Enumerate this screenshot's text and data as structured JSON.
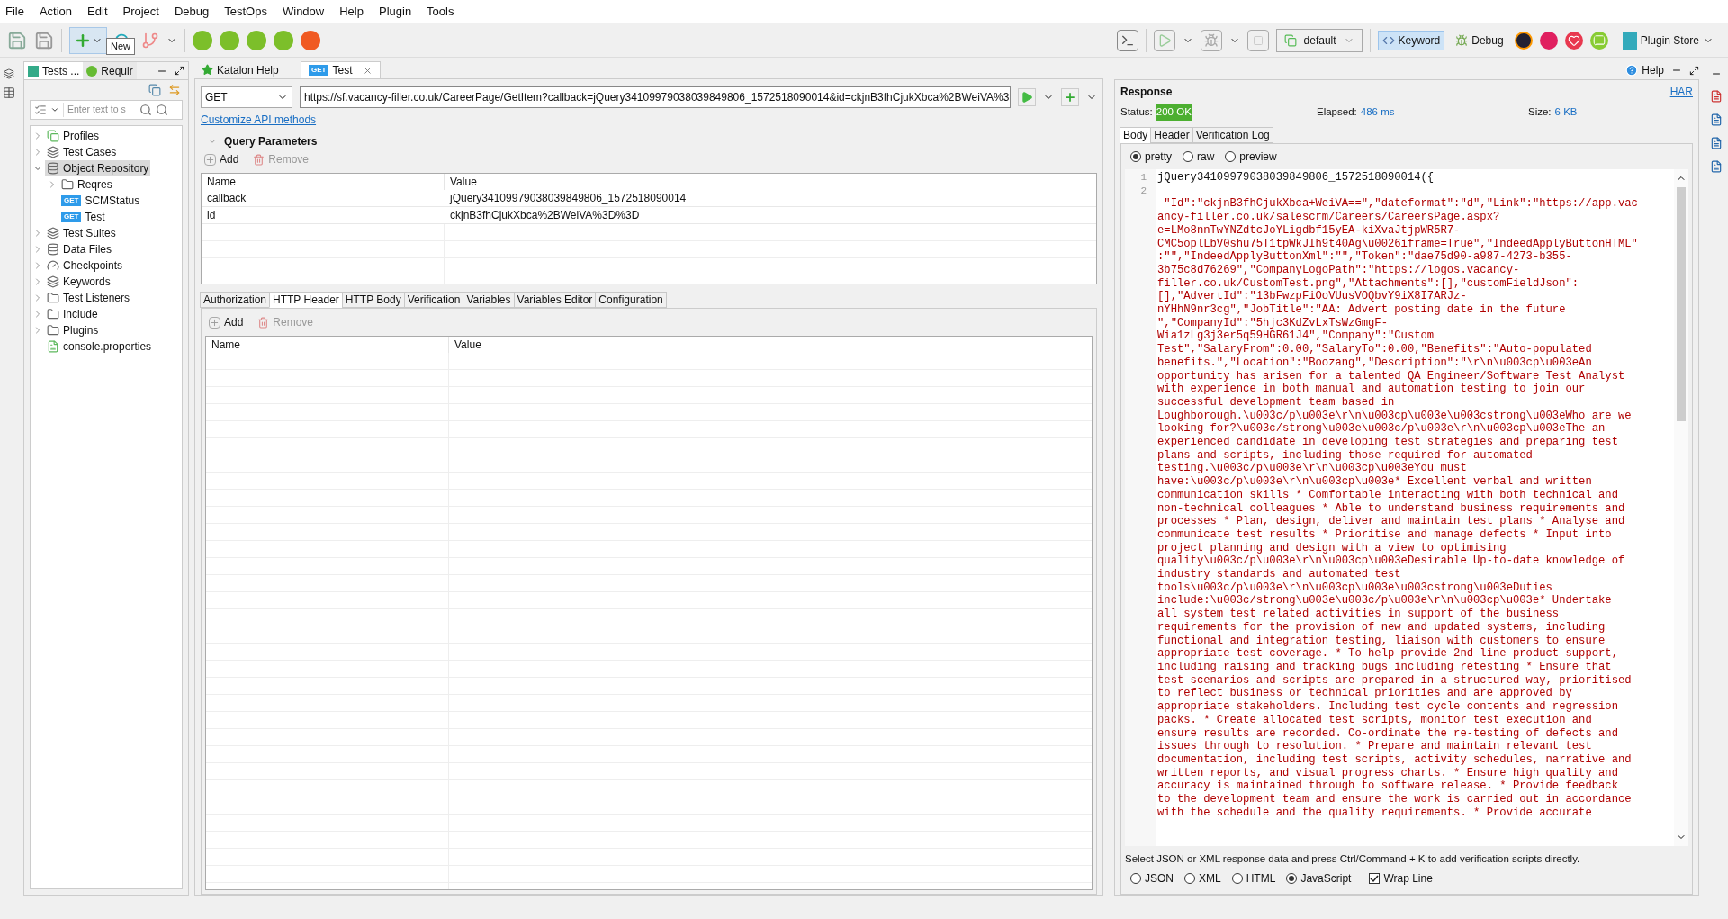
{
  "menu": [
    "File",
    "Action",
    "Edit",
    "Project",
    "Debug",
    "TestOps",
    "Window",
    "Help",
    "Plugin",
    "Tools"
  ],
  "toolbar": {
    "tooltip": "New",
    "profile": "default",
    "perspectives": [
      {
        "label": "Keyword",
        "selected": true
      },
      {
        "label": "Debug",
        "selected": false
      }
    ],
    "plugin_store": "Plugin Store"
  },
  "explorer": {
    "tabs": [
      {
        "label": "Tests ...",
        "selected": true
      },
      {
        "label": "Requir",
        "selected": false
      }
    ],
    "search": {
      "placeholder": "Enter text to s"
    },
    "tree": [
      {
        "label": "Profiles",
        "kind": "profiles",
        "expanded": false,
        "selected": false
      },
      {
        "label": "Test Cases",
        "kind": "cases",
        "expanded": false,
        "selected": false
      },
      {
        "label": "Object Repository",
        "kind": "repo",
        "expanded": true,
        "selected": true,
        "children": [
          {
            "label": "Reqres",
            "kind": "folder",
            "expanded": false,
            "selected": false
          },
          {
            "label": "SCMStatus",
            "kind": "request",
            "badge": "GET",
            "selected": false
          },
          {
            "label": "Test",
            "kind": "request",
            "badge": "GET",
            "selected": false
          }
        ]
      },
      {
        "label": "Test Suites",
        "kind": "cases",
        "expanded": false,
        "selected": false
      },
      {
        "label": "Data Files",
        "kind": "data",
        "expanded": false,
        "selected": false
      },
      {
        "label": "Checkpoints",
        "kind": "checkpoint",
        "expanded": false,
        "selected": false
      },
      {
        "label": "Keywords",
        "kind": "cases",
        "expanded": false,
        "selected": false
      },
      {
        "label": "Test Listeners",
        "kind": "folder",
        "expanded": false,
        "selected": false
      },
      {
        "label": "Include",
        "kind": "folder",
        "expanded": false,
        "selected": false
      },
      {
        "label": "Plugins",
        "kind": "folder",
        "expanded": false,
        "selected": false
      },
      {
        "label": "console.properties",
        "kind": "file",
        "selected": false
      }
    ]
  },
  "editor_tabs": [
    {
      "label": "Katalon Help",
      "selected": false
    },
    {
      "label": "Test",
      "badge": "GET",
      "selected": true
    }
  ],
  "help": "Help",
  "request": {
    "method": "GET",
    "url": "https://sf.vacancy-filler.co.uk/CareerPage/GetItem?callback=jQuery34109979038039849806_1572518090014&id=ckjnB3fhCjukXbca%2BWeiVA%3",
    "customize_link": "Customize API methods",
    "query": {
      "title": "Query Parameters",
      "expanded": true,
      "add": "Add",
      "remove": "Remove",
      "columns": [
        "Name",
        "Value"
      ],
      "rows": [
        [
          "callback",
          "jQuery34109979038039849806_1572518090014"
        ],
        [
          "id",
          "ckjnB3fhCjukXbca%2BWeiVA%3D%3D"
        ]
      ]
    },
    "tabs": [
      {
        "label": "Authorization",
        "selected": false
      },
      {
        "label": "HTTP Header",
        "selected": true
      },
      {
        "label": "HTTP Body",
        "selected": false
      },
      {
        "label": "Verification",
        "selected": false
      },
      {
        "label": "Variables",
        "selected": false
      },
      {
        "label": "Variables Editor",
        "selected": false
      },
      {
        "label": "Configuration",
        "selected": false
      }
    ],
    "header_table": {
      "add": "Add",
      "remove": "Remove",
      "columns": [
        "Name",
        "Value"
      ]
    }
  },
  "response": {
    "title": "Response",
    "har": "HAR",
    "status_label": "Status:",
    "status": "200 OK",
    "elapsed_label": "Elapsed:",
    "elapsed": "486 ms",
    "size_label": "Size:",
    "size": "6 KB",
    "tabs": [
      {
        "label": "Body",
        "selected": true
      },
      {
        "label": "Header",
        "selected": false
      },
      {
        "label": "Verification Log",
        "selected": false
      }
    ],
    "modes": [
      {
        "label": "pretty",
        "selected": true
      },
      {
        "label": "raw",
        "selected": false
      },
      {
        "label": "preview",
        "selected": false
      }
    ],
    "gutter": [
      "1",
      "2"
    ],
    "first_line": "jQuery34109979038039849806_1572518090014({",
    "lines": [
      " \"Id\":\"ckjnB3fhCjukXbca+WeiVA==\",\"dateformat\":\"d\",\"Link\":\"https://app.vac",
      "ancy-filler.co.uk/salescrm/Careers/CareersPage.aspx?",
      "e=LMo8nnTwYNZdtcJoYLigdbf15yEA-kiXvaJtjpWR5R7-",
      "CMC5oplLbV0shu75T1tpWkJIh9t40Ag\\u0026iframe=True\",\"IndeedApplyButtonHTML\"",
      ":\"\",\"IndeedApplyButtonXml\":\"\",\"Token\":\"dae75d90-a987-4273-b355-",
      "3b75c8d76269\",\"CompanyLogoPath\":\"https://logos.vacancy-",
      "filler.co.uk/CustomTest.png\",\"Attachments\":[],\"customFieldJson\":",
      "[],\"AdvertId\":\"13bFwzpFiOoVUusVOQbvY9iX8I7ARJz-",
      "nYHhN9nr3cg\",\"JobTitle\":\"AA: Advert posting date in the future",
      "\",\"CompanyId\":\"5hjc3KdZvLxTsWzGmgF-",
      "Wia1zLg3j3er5q59HGR61J4\",\"Company\":\"Custom",
      "Test\",\"SalaryFrom\":0.00,\"SalaryTo\":0.00,\"Benefits\":\"Auto-populated",
      "benefits.\",\"Location\":\"Boozang\",\"Description\":\"\\r\\n\\u003cp\\u003eAn",
      "opportunity has arisen for a talented QA Engineer/Software Test Analyst",
      "with experience in both manual and automation testing to join our",
      "successful development team based in",
      "Loughborough.\\u003c/p\\u003e\\r\\n\\u003cp\\u003e\\u003cstrong\\u003eWho are we",
      "looking for?\\u003c/strong\\u003e\\u003c/p\\u003e\\r\\n\\u003cp\\u003eThe an",
      "experienced candidate in developing test strategies and preparing test",
      "plans and scripts, including those required for automated",
      "testing.\\u003c/p\\u003e\\r\\n\\u003cp\\u003eYou must",
      "have:\\u003c/p\\u003e\\r\\n\\u003cp\\u003e* Excellent verbal and written",
      "communication skills * Comfortable interacting with both technical and",
      "non-technical colleagues * Able to understand business requirements and",
      "processes * Plan, design, deliver and maintain test plans * Analyse and",
      "communicate test results * Prioritise and manage defects * Input into",
      "project planning and design with a view to optimising",
      "quality\\u003c/p\\u003e\\r\\n\\u003cp\\u003eDesirable Up-to-date knowledge of",
      "industry standards and automated test",
      "tools\\u003c/p\\u003e\\r\\n\\u003cp\\u003e\\u003cstrong\\u003eDuties",
      "include:\\u003c/strong\\u003e\\u003c/p\\u003e\\r\\n\\u003cp\\u003e* Undertake",
      "all system test related activities in support of the business",
      "requirements for the provision of new and updated systems, including",
      "functional and integration testing, liaison with customers to ensure",
      "appropriate test coverage. * To help provide 2nd line product support,",
      "including raising and tracking bugs including retesting * Ensure that",
      "test scenarios and scripts are prepared in a structured way, prioritised",
      "to reflect business or technical priorities and are approved by",
      "appropriate stakeholders. Including test cycle contents and regression",
      "packs. * Create allocated test scripts, monitor test execution and",
      "ensure results are recorded. Co-ordinate the re-testing of defects and",
      "issues through to resolution. * Prepare and maintain relevant test",
      "documentation, including test scripts, activity schedules, narrative and",
      "written reports, and visual progress charts. * Ensure high quality and",
      "accuracy is maintained through to software release. * Provide feedback",
      "to the development team and ensure the work is carried out in accordance",
      "with the schedule and the quality requirements. * Provide accurate"
    ],
    "hint": "Select JSON or XML response data and press Ctrl/Command + K to add verification scripts directly.",
    "formats": [
      {
        "label": "JSON",
        "selected": false
      },
      {
        "label": "XML",
        "selected": false
      },
      {
        "label": "HTML",
        "selected": false
      },
      {
        "label": "JavaScript",
        "selected": true
      }
    ],
    "wrap": {
      "label": "Wrap Line",
      "checked": true
    }
  }
}
